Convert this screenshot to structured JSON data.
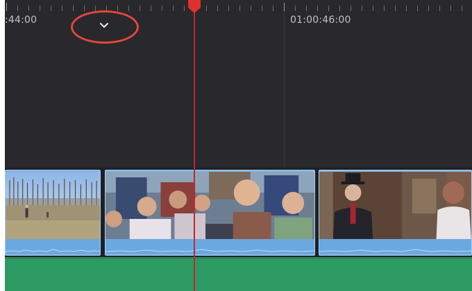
{
  "ruler": {
    "timecode_left": ":44:00",
    "timecode_right": "01:00:46:00"
  },
  "controls": {
    "expand_chevron_icon": "chevron-down-icon",
    "highlight_color": "#e8453a"
  },
  "playhead": {
    "color": "#c2272a"
  },
  "tracks": {
    "video": {
      "clips": [
        {
          "id": "clip-1",
          "scene": "field-landscape"
        },
        {
          "id": "clip-2",
          "scene": "crowd-cheering"
        },
        {
          "id": "clip-3",
          "scene": "man-top-hat"
        }
      ],
      "clip_color": "#7fb3e2"
    },
    "audio": {
      "color": "#2e9a63"
    }
  }
}
